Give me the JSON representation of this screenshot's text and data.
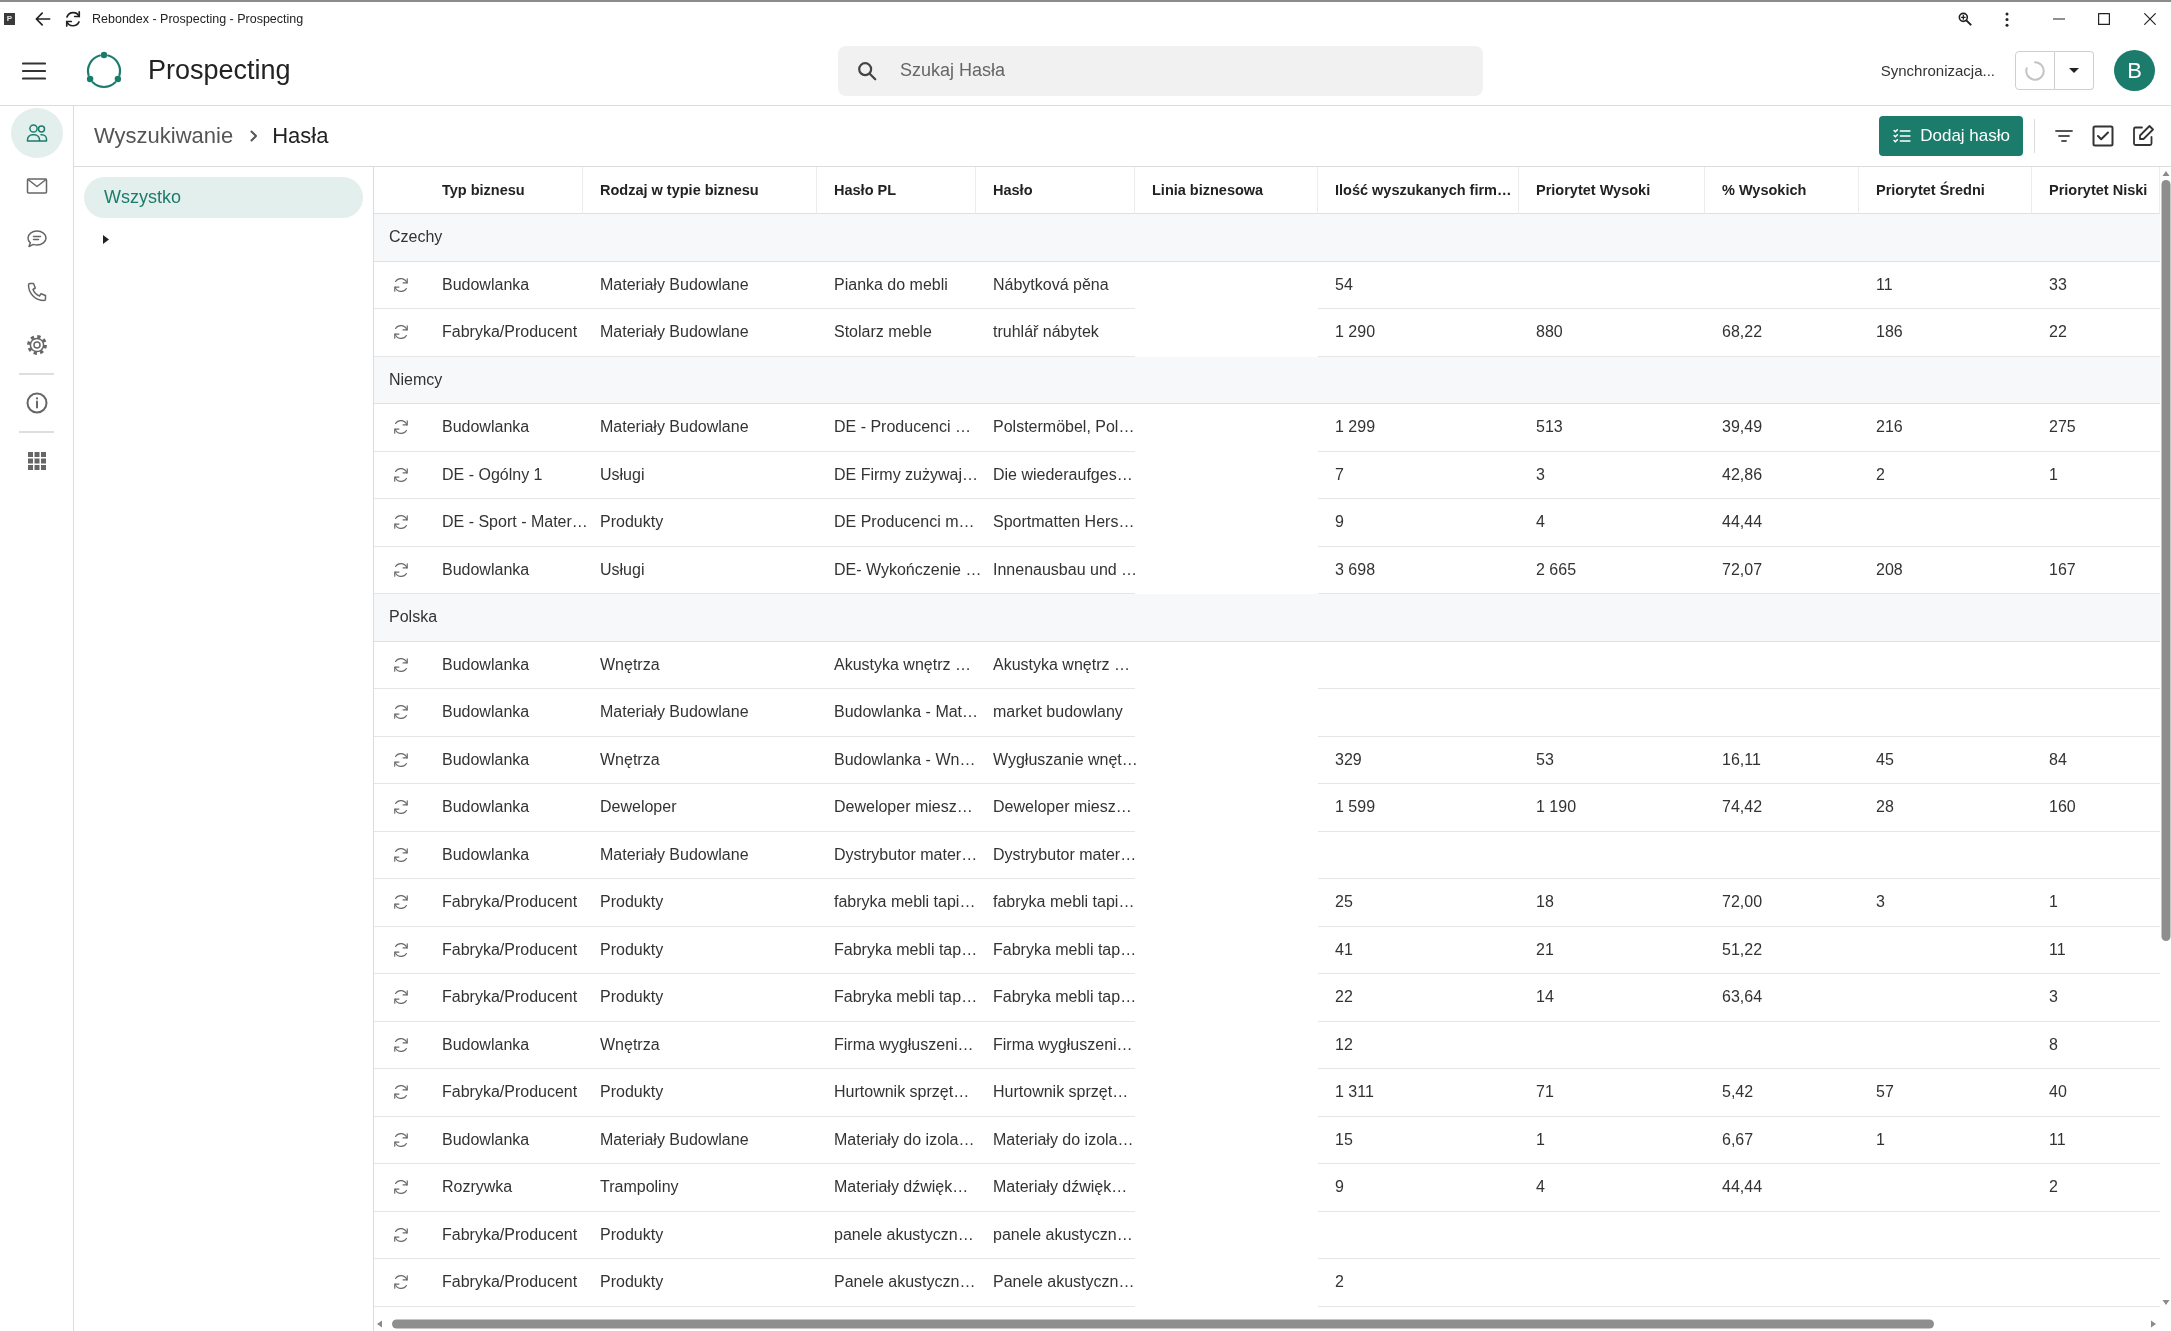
{
  "window": {
    "app_logo": "P",
    "title": "Rebondex - Prospecting - Prospecting"
  },
  "app_bar": {
    "title": "Prospecting",
    "search": {
      "placeholder": "Szukaj Hasła"
    },
    "sync_status": "Synchronizacja...",
    "avatar": "B"
  },
  "nav_rail": {
    "groups": [
      [
        {
          "selected": true
        },
        {
          "selected": false
        },
        {
          "selected": false
        },
        {
          "selected": false
        },
        {
          "selected": false
        }
      ],
      [
        {
          "selected": false
        }
      ],
      [
        {
          "selected": false
        }
      ]
    ]
  },
  "breadcrumb": [
    "Wyszukiwanie",
    "Hasła"
  ],
  "toolbar": {
    "add_button": "Dodaj hasło"
  },
  "filter_tree": {
    "items": [
      {
        "label": "Wszystko",
        "selected": true
      }
    ],
    "expander": {
      "expanded": false
    }
  },
  "table": {
    "columns": {
      "typ": "Typ biznesu",
      "rodzaj": "Rodzaj w typie biznesu",
      "haslo_pl": "Hasło PL",
      "haslo": "Hasło",
      "linia": "Linia biznesowa",
      "ilosc": "Ilość wyszukanych firm…",
      "wysoki": "Priorytet Wysoki",
      "proc_wysokich": "% Wysokich",
      "sredni": "Priorytet Średni",
      "niski": "Priorytet Niski"
    },
    "groups": [
      {
        "label": "Czechy",
        "rows": [
          {
            "typ": "Budowlanka",
            "rodzaj": "Materiały Budowlane",
            "haslo_pl": "Pianka do mebli",
            "haslo": "Nábytková pěna",
            "ilosc": "54",
            "sredni": "11",
            "niski": "33"
          },
          {
            "typ": "Fabryka/Producent",
            "rodzaj": "Materiały Budowlane",
            "haslo_pl": "Stolarz meble",
            "haslo": "truhlář nábytek",
            "ilosc": "1 290",
            "wysoki": "880",
            "proc_wysokich": "68,22",
            "sredni": "186",
            "niski": "22"
          }
        ]
      },
      {
        "label": "Niemcy",
        "rows": [
          {
            "typ": "Budowlanka",
            "rodzaj": "Materiały Budowlane",
            "haslo_pl": "DE - Producenci …",
            "haslo": "Polstermöbel, Pol…",
            "ilosc": "1 299",
            "wysoki": "513",
            "proc_wysokich": "39,49",
            "sredni": "216",
            "niski": "275"
          },
          {
            "typ": "DE - Ogólny 1",
            "rodzaj": "Usługi",
            "haslo_pl": "DE Firmy zużywaj…",
            "haslo": "Die wiederaufges…",
            "ilosc": "7",
            "wysoki": "3",
            "proc_wysokich": "42,86",
            "sredni": "2",
            "niski": "1"
          },
          {
            "typ": "DE - Sport - Mater…",
            "rodzaj": "Produkty",
            "haslo_pl": "DE Producenci m…",
            "haslo": "Sportmatten Hers…",
            "ilosc": "9",
            "wysoki": "4",
            "proc_wysokich": "44,44"
          },
          {
            "typ": "Budowlanka",
            "rodzaj": "Usługi",
            "haslo_pl": "DE- Wykończenie …",
            "haslo": "Innenausbau und …",
            "ilosc": "3 698",
            "wysoki": "2 665",
            "proc_wysokich": "72,07",
            "sredni": "208",
            "niski": "167"
          }
        ]
      },
      {
        "label": "Polska",
        "rows": [
          {
            "typ": "Budowlanka",
            "rodzaj": "Wnętrza",
            "haslo_pl": "Akustyka wnętrz …",
            "haslo": "Akustyka wnętrz …"
          },
          {
            "typ": "Budowlanka",
            "rodzaj": "Materiały Budowlane",
            "haslo_pl": "Budowlanka - Mat…",
            "haslo": "market budowlany"
          },
          {
            "typ": "Budowlanka",
            "rodzaj": "Wnętrza",
            "haslo_pl": "Budowlanka - Wn…",
            "haslo": "Wygłuszanie wnęt…",
            "ilosc": "329",
            "wysoki": "53",
            "proc_wysokich": "16,11",
            "sredni": "45",
            "niski": "84"
          },
          {
            "typ": "Budowlanka",
            "rodzaj": "Deweloper",
            "haslo_pl": "Deweloper miesz…",
            "haslo": "Deweloper miesz…",
            "ilosc": "1 599",
            "wysoki": "1 190",
            "proc_wysokich": "74,42",
            "sredni": "28",
            "niski": "160"
          },
          {
            "typ": "Budowlanka",
            "rodzaj": "Materiały Budowlane",
            "haslo_pl": "Dystrybutor mater…",
            "haslo": "Dystrybutor mater…"
          },
          {
            "typ": "Fabryka/Producent",
            "rodzaj": "Produkty",
            "haslo_pl": "fabryka mebli tapi…",
            "haslo": "fabryka mebli tapi…",
            "ilosc": "25",
            "wysoki": "18",
            "proc_wysokich": "72,00",
            "sredni": "3",
            "niski": "1"
          },
          {
            "typ": "Fabryka/Producent",
            "rodzaj": "Produkty",
            "haslo_pl": "Fabryka mebli tap…",
            "haslo": "Fabryka mebli tap…",
            "ilosc": "41",
            "wysoki": "21",
            "proc_wysokich": "51,22",
            "niski": "11"
          },
          {
            "typ": "Fabryka/Producent",
            "rodzaj": "Produkty",
            "haslo_pl": "Fabryka mebli tap…",
            "haslo": "Fabryka mebli tap…",
            "ilosc": "22",
            "wysoki": "14",
            "proc_wysokich": "63,64",
            "niski": "3"
          },
          {
            "typ": "Budowlanka",
            "rodzaj": "Wnętrza",
            "haslo_pl": "Firma wygłuszeni…",
            "haslo": "Firma wygłuszeni…",
            "ilosc": "12",
            "niski": "8"
          },
          {
            "typ": "Fabryka/Producent",
            "rodzaj": "Produkty",
            "haslo_pl": "Hurtownik sprzęt…",
            "haslo": "Hurtownik sprzęt…",
            "ilosc": "1 311",
            "wysoki": "71",
            "proc_wysokich": "5,42",
            "sredni": "57",
            "niski": "40"
          },
          {
            "typ": "Budowlanka",
            "rodzaj": "Materiały Budowlane",
            "haslo_pl": "Materiały do izola…",
            "haslo": "Materiały do izola…",
            "ilosc": "15",
            "wysoki": "1",
            "proc_wysokich": "6,67",
            "sredni": "1",
            "niski": "11"
          },
          {
            "typ": "Rozrywka",
            "rodzaj": "Trampoliny",
            "haslo_pl": "Materiały dźwięk…",
            "haslo": "Materiały dźwięk…",
            "ilosc": "9",
            "wysoki": "4",
            "proc_wysokich": "44,44",
            "niski": "2"
          },
          {
            "typ": "Fabryka/Producent",
            "rodzaj": "Produkty",
            "haslo_pl": "panele akustyczn…",
            "haslo": "panele akustyczn…"
          },
          {
            "typ": "Fabryka/Producent",
            "rodzaj": "Produkty",
            "haslo_pl": "Panele akustyczn…",
            "haslo": "Panele akustyczn…",
            "ilosc": "2"
          }
        ]
      }
    ]
  }
}
